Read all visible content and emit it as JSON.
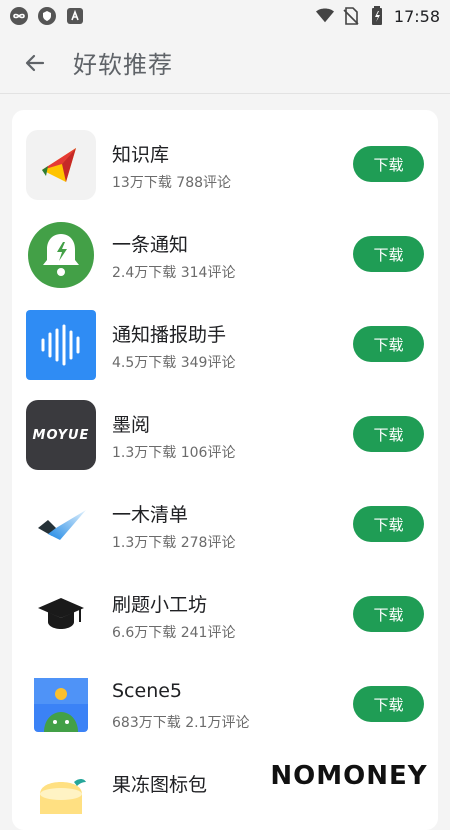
{
  "status_bar": {
    "time": "17:58",
    "icons": [
      "infinity-icon",
      "shield-icon",
      "font-a-icon",
      "wifi-icon",
      "no-sim-icon",
      "battery-icon"
    ]
  },
  "header": {
    "title": "好软推荐",
    "back_icon": "arrow-left-icon"
  },
  "apps": [
    {
      "name": "知识库",
      "downloads": "13万下载",
      "reviews": "788评论",
      "button": "下载",
      "icon": "zhishiku-logo"
    },
    {
      "name": "一条通知",
      "downloads": "2.4万下载",
      "reviews": "314评论",
      "button": "下载",
      "icon": "bell-icon"
    },
    {
      "name": "通知播报助手",
      "downloads": "4.5万下载",
      "reviews": "349评论",
      "button": "下载",
      "icon": "waveform-icon"
    },
    {
      "name": "墨阅",
      "downloads": "1.3万下载",
      "reviews": "106评论",
      "button": "下载",
      "icon": "moyue-logo",
      "icon_text": "MOYUE"
    },
    {
      "name": "一木清单",
      "downloads": "1.3万下载",
      "reviews": "278评论",
      "button": "下载",
      "icon": "checkmark-logo"
    },
    {
      "name": "刷题小工坊",
      "downloads": "6.6万下载",
      "reviews": "241评论",
      "button": "下载",
      "icon": "graduation-cap-icon"
    },
    {
      "name": "Scene5",
      "downloads": "683万下载",
      "reviews": "2.1万评论",
      "button": "下载",
      "icon": "android-icon"
    },
    {
      "name": "果冻图标包",
      "downloads": "",
      "reviews": "",
      "button": "",
      "icon": "jelly-icon"
    }
  ],
  "watermark": {
    "text": "NOMONEY"
  },
  "colors": {
    "accent": "#1f9d55",
    "background": "#f4f4f4",
    "card": "#ffffff"
  }
}
